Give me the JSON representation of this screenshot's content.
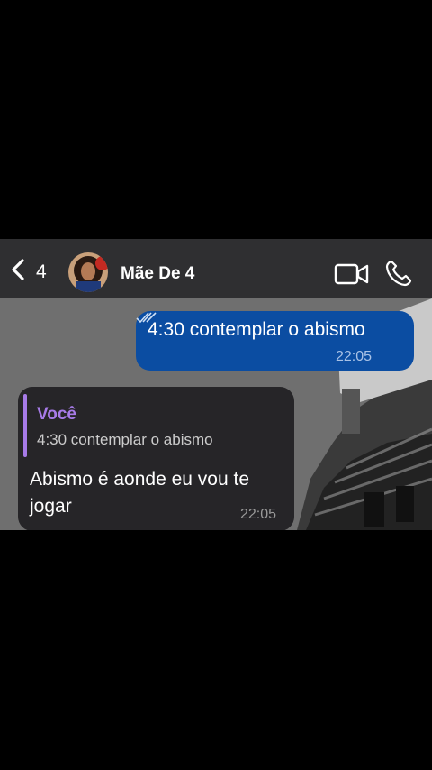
{
  "header": {
    "back_count": "4",
    "contact_name": "Mãe De 4"
  },
  "messages": {
    "outgoing": {
      "text": "4:30 contemplar o abismo",
      "time": "22:05",
      "status": "read"
    },
    "incoming": {
      "quote_author": "Você",
      "quote_text": "4:30 contemplar o abismo",
      "text": "Abismo é aonde eu vou te jogar",
      "time": "22:05"
    }
  },
  "colors": {
    "header_bg": "#2f2f31",
    "outgoing_bubble": "#0b4da2",
    "incoming_bubble": "#262528",
    "quote_accent": "#a77be8"
  },
  "icons": [
    "chevron-left-icon",
    "video-camera-icon",
    "phone-icon",
    "double-check-icon"
  ]
}
